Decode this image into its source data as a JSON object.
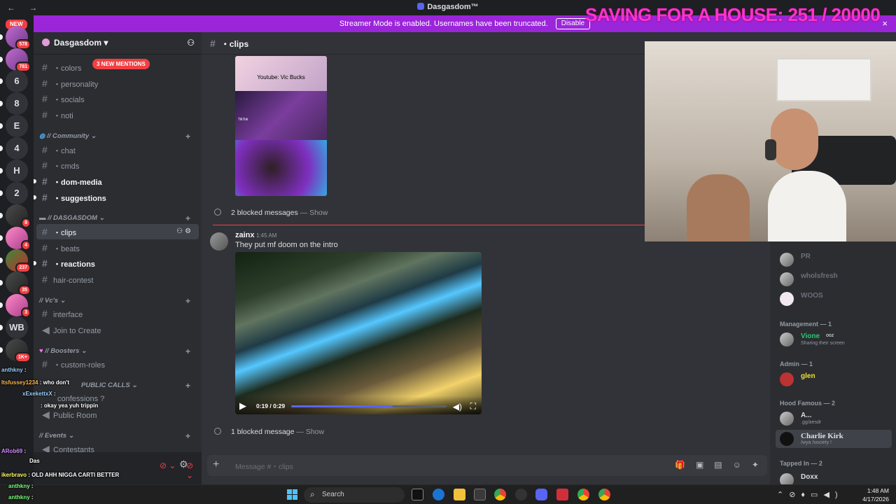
{
  "titlebar": {
    "title": "Dasgasdom™",
    "nav": "← →"
  },
  "overlay": {
    "text": "SAVING FOR A HOUSE: 251 / 20000"
  },
  "banner": {
    "text": "Streamer Mode is enabled. Usernames have been truncated.",
    "button": "Disable",
    "close": "×"
  },
  "rail": {
    "new_label": "NEW",
    "items": [
      {
        "label": "",
        "badge": "578"
      },
      {
        "label": "",
        "badge": "781"
      },
      {
        "label": "6",
        "badge": ""
      },
      {
        "label": "8",
        "badge": ""
      },
      {
        "label": "E",
        "badge": ""
      },
      {
        "label": "4",
        "badge": ""
      },
      {
        "label": "H",
        "badge": ""
      },
      {
        "label": "2",
        "badge": ""
      },
      {
        "label": "",
        "badge": "8"
      },
      {
        "label": "",
        "badge": "4"
      },
      {
        "label": "",
        "badge": "237"
      },
      {
        "label": "",
        "badge": "35"
      },
      {
        "label": "",
        "badge": "3"
      },
      {
        "label": "WB",
        "badge": ""
      },
      {
        "label": "",
        "badge": "1K+"
      }
    ]
  },
  "guild": {
    "name": "Dasgasdom"
  },
  "mention_pill": "3 NEW MENTIONS",
  "channels": {
    "colors": "・colors",
    "personality": "・personality",
    "socials": "・socials",
    "noti": "・noti",
    "cat_community": "// Community",
    "chat": "・chat",
    "cmds": "・cmds",
    "dom_media": "・dom-media",
    "suggestions": "・suggestions",
    "cat_dasgasdom": "// DASGASDOM",
    "clips": "・clips",
    "beats": "・beats",
    "reactions": "・reactions",
    "hair_contest": "hair-contest",
    "cat_vcs": "// Vc's",
    "interface": "interface",
    "join_to_create": "Join to Create",
    "cat_boosters": "// Boosters",
    "custom_roles": "・custom-roles",
    "cat_public_calls": "PUBLIC CALLS",
    "confessions": "confessions ?",
    "public_room": "Public Room",
    "cat_events": "// Events",
    "contestants": "Contestants"
  },
  "stream_chat": [
    {
      "user": "anthkny",
      "text": ":"
    },
    {
      "user": "Itsfussey1234",
      "text": ": who don't"
    },
    {
      "user": "xExekettxX",
      "text": ":"
    },
    {
      "user": "",
      "text": ": okay yea yuh trippin"
    },
    {
      "user": "ARob69",
      "text": ":"
    },
    {
      "user": "Das",
      "text": ""
    },
    {
      "user": "",
      "text": "Do Not Disturb"
    },
    {
      "user": "ikerbravo",
      "text": ": OLD AHH NIGGA CARTI BETTER"
    },
    {
      "user": "anthkny",
      "text": ":"
    },
    {
      "user": "anthkny",
      "text": ":"
    }
  ],
  "header": {
    "channel": "・clips"
  },
  "thumb_caption": "Youtube: Vic Bucks",
  "thumb_caption2": "TikTok",
  "blocked1": {
    "text": "2 blocked messages",
    "show": "— Show"
  },
  "message": {
    "author": "zainx",
    "time": "1:45 AM",
    "text": "They put mf doom on the intro"
  },
  "video": {
    "time": "0:19 / 0:29",
    "progress": 0.655
  },
  "blocked2": {
    "text": "1 blocked message",
    "show": "— Show"
  },
  "composer": {
    "placeholder": "Message #・clips"
  },
  "members": {
    "top": [
      {
        "name": "PR",
        "sub": ""
      },
      {
        "name": "wholsfresh",
        "sub": ""
      },
      {
        "name": "WOOS",
        "sub": ""
      }
    ],
    "groups": [
      {
        "title": "Management — 1",
        "members": [
          {
            "name": "Vione",
            "sub": "Sharing their screen",
            "tag": "ooz"
          }
        ]
      },
      {
        "title": "Admin — 1",
        "members": [
          {
            "name": "glen",
            "sub": ""
          }
        ]
      },
      {
        "title": "Hood Famous — 2",
        "members": [
          {
            "name": "A...",
            "sub": ".gg/aesdr"
          },
          {
            "name": "Charlie Kirk",
            "sub": "/wya /society !"
          }
        ]
      },
      {
        "title": "Tapped In — 2",
        "members": [
          {
            "name": "Doxx",
            "sub": ""
          }
        ]
      }
    ]
  },
  "taskbar": {
    "search": "Search",
    "time": "1:48 AM",
    "date": "4/17/2026"
  },
  "colors": {
    "accent": "#5865f2",
    "banner": "#9b25d9",
    "overlay": "#ff33cc",
    "danger": "#f23f42"
  }
}
